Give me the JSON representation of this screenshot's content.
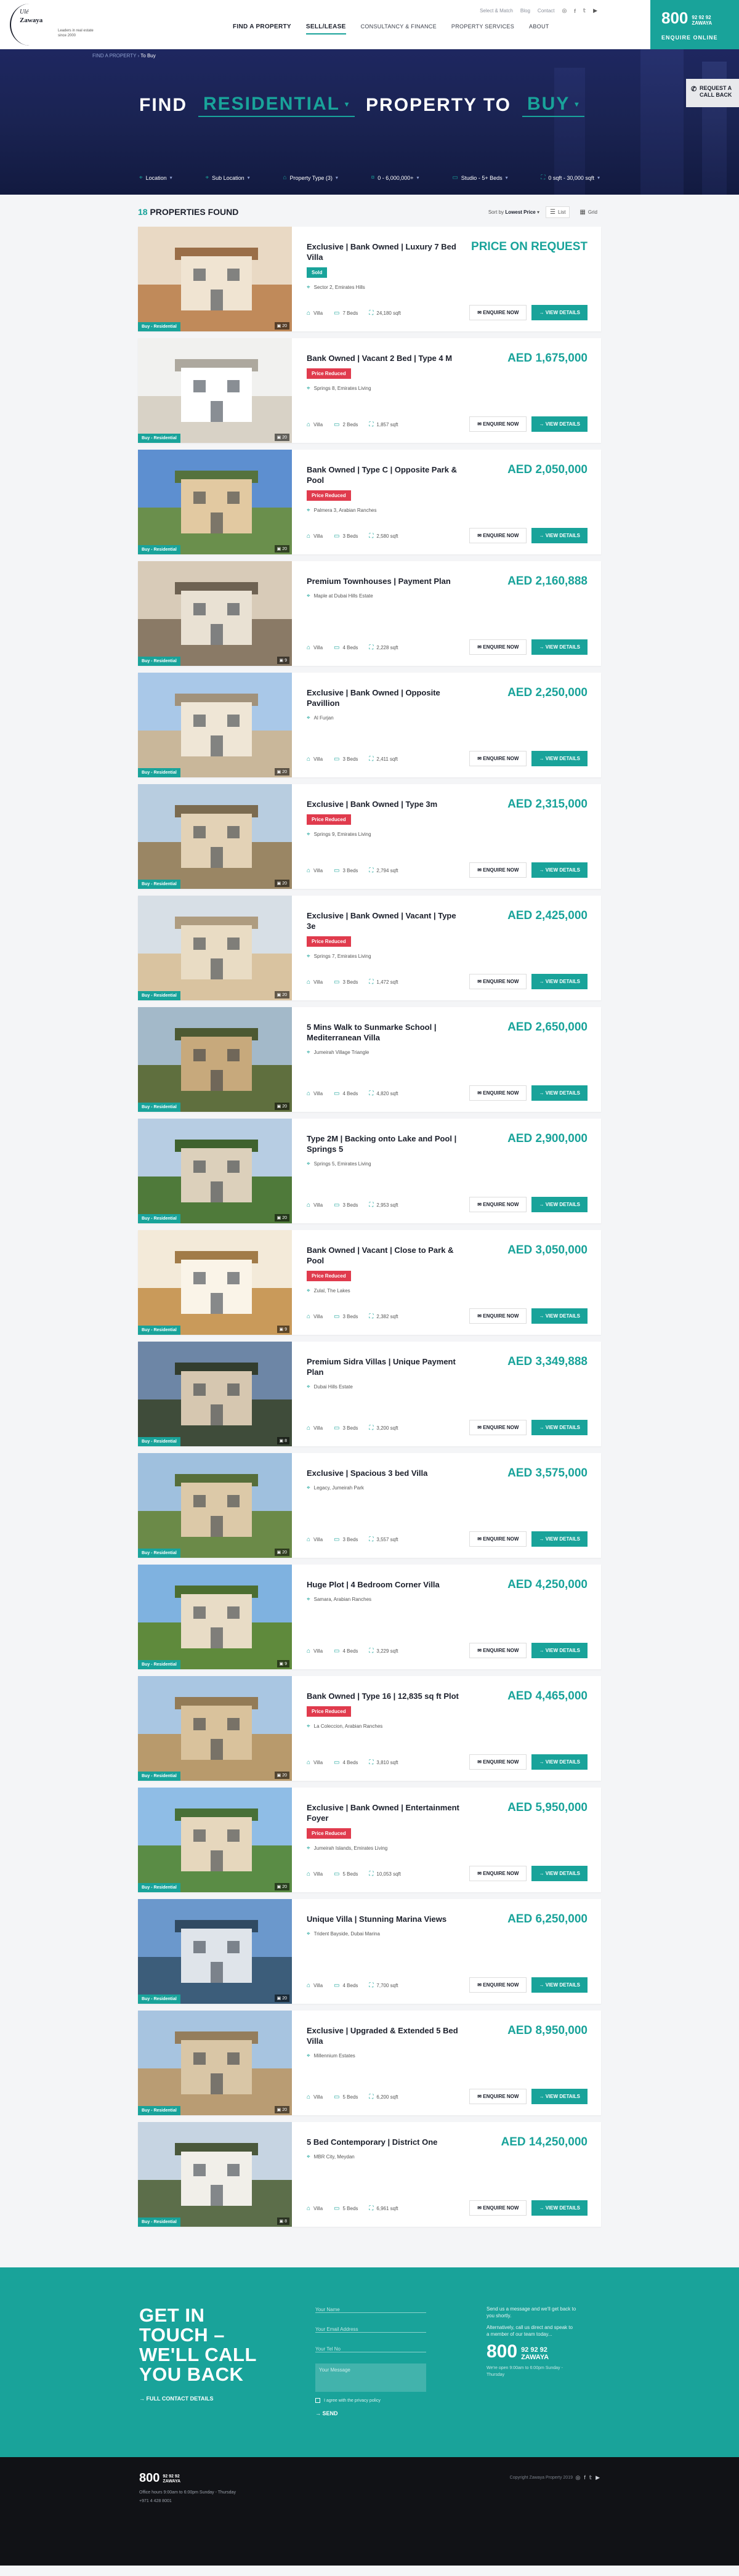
{
  "header": {
    "logo_line1": "Ulé",
    "logo_line2": "Zawaya",
    "tagline": "Leaders in real estate since 2000",
    "top_links": [
      "Select & Match",
      "Blog",
      "Contact"
    ],
    "social_icons": [
      "instagram",
      "facebook",
      "twitter",
      "youtube"
    ],
    "nav": [
      {
        "label": "FIND A PROPERTY",
        "active": false
      },
      {
        "label": "SELL/LEASE",
        "active": true
      },
      {
        "label": "CONSULTANCY & FINANCE",
        "active": false
      },
      {
        "label": "PROPERTY SERVICES",
        "active": false
      },
      {
        "label": "ABOUT",
        "active": false
      }
    ],
    "callbox": {
      "big": "800",
      "small": "92 92 92",
      "small2": "ZAWAYA",
      "cta": "ENQUIRE ONLINE"
    }
  },
  "hero": {
    "breadcrumb_prev": "FIND A PROPERTY",
    "breadcrumb_current": "To Buy",
    "find": "FIND",
    "type": "RESIDENTIAL",
    "property_to": "PROPERTY TO",
    "purpose": "BUY",
    "callback": [
      "REQUEST A",
      "CALL BACK"
    ],
    "filters": [
      {
        "icon": "location-icon",
        "label": "Location"
      },
      {
        "icon": "location-icon",
        "label": "Sub Location"
      },
      {
        "icon": "home-icon",
        "label": "Property Type (3)"
      },
      {
        "icon": "price-icon",
        "label": "0 - 6,000,000+"
      },
      {
        "icon": "bed-icon",
        "label": "Studio - 5+ Beds"
      },
      {
        "icon": "area-icon",
        "label": "0 sqft - 30,000 sqft"
      }
    ]
  },
  "listing": {
    "count": "18",
    "count_label": "PROPERTIES FOUND",
    "sort_prefix": "Sort by",
    "sort_value": "Lowest Price",
    "view_list": "List",
    "view_grid": "Grid",
    "enquire_label": "ENQUIRE NOW",
    "view_label": "VIEW DETAILS",
    "thumb_tag": "Buy - Residential",
    "properties": [
      {
        "title": "Exclusive | Bank Owned | Luxury 7 Bed Villa",
        "price": "PRICE ON REQUEST",
        "badge": "Sold",
        "badge_type": "sold",
        "location": "Sector 2, Emirates Hills",
        "type": "Villa",
        "beds": "7 Beds",
        "area": "24,180 sqft",
        "photos": "20",
        "palette": [
          "#e9d9c4",
          "#c08a5a",
          "#f0e4d2"
        ]
      },
      {
        "title": "Bank Owned | Vacant 2 Bed | Type 4 M",
        "price": "AED 1,675,000",
        "badge": "Price Reduced",
        "badge_type": "reduced",
        "location": "Springs 8, Emirates Living",
        "type": "Villa",
        "beds": "2 Beds",
        "area": "1,857 sqft",
        "photos": "20",
        "palette": [
          "#f1f1ef",
          "#d8d2c6",
          "#ffffff"
        ]
      },
      {
        "title": "Bank Owned | Type C | Opposite Park & Pool",
        "price": "AED 2,050,000",
        "badge": "Price Reduced",
        "badge_type": "reduced",
        "location": "Palmera 3, Arabian Ranches",
        "type": "Villa",
        "beds": "3 Beds",
        "area": "2,580 sqft",
        "photos": "20",
        "palette": [
          "#5d8fd0",
          "#6a8f4c",
          "#e2c9a1"
        ]
      },
      {
        "title": "Premium Townhouses | Payment Plan",
        "price": "AED 2,160,888",
        "badge": "",
        "badge_type": "",
        "location": "Maple at Dubai Hills Estate",
        "type": "Villa",
        "beds": "4 Beds",
        "area": "2,228 sqft",
        "photos": "9",
        "palette": [
          "#d8cbb8",
          "#8a7a66",
          "#e9e1d3"
        ]
      },
      {
        "title": "Exclusive | Bank Owned | Opposite Pavillion",
        "price": "AED 2,250,000",
        "badge": "",
        "badge_type": "",
        "location": "Al Furjan",
        "type": "Villa",
        "beds": "3 Beds",
        "area": "2,411 sqft",
        "photos": "20",
        "palette": [
          "#a9c8e8",
          "#c9b79a",
          "#efe6d6"
        ]
      },
      {
        "title": "Exclusive | Bank Owned | Type 3m",
        "price": "AED 2,315,000",
        "badge": "Price Reduced",
        "badge_type": "reduced",
        "location": "Springs 9, Emirates Living",
        "type": "Villa",
        "beds": "3 Beds",
        "area": "2,794 sqft",
        "photos": "20",
        "palette": [
          "#b8cde0",
          "#9a8664",
          "#e3d2b6"
        ]
      },
      {
        "title": "Exclusive | Bank Owned | Vacant | Type 3e",
        "price": "AED 2,425,000",
        "badge": "Price Reduced",
        "badge_type": "reduced",
        "location": "Springs 7, Emirates Living",
        "type": "Villa",
        "beds": "3 Beds",
        "area": "1,472 sqft",
        "photos": "20",
        "palette": [
          "#d7dfe6",
          "#d9c3a0",
          "#e9dcc4"
        ]
      },
      {
        "title": "5 Mins Walk to Sunmarke School | Mediterranean Villa",
        "price": "AED 2,650,000",
        "badge": "",
        "badge_type": "",
        "location": "Jumeirah Village Triangle",
        "type": "Villa",
        "beds": "4 Beds",
        "area": "4,820 sqft",
        "photos": "20",
        "palette": [
          "#a3b9c9",
          "#5f6f3e",
          "#c7a97c"
        ]
      },
      {
        "title": "Type 2M | Backing onto Lake and Pool | Springs 5",
        "price": "AED 2,900,000",
        "badge": "",
        "badge_type": "",
        "location": "Springs 5, Emirates Living",
        "type": "Villa",
        "beds": "3 Beds",
        "area": "2,953 sqft",
        "photos": "20",
        "palette": [
          "#b7cde3",
          "#4f7a3a",
          "#dcd0bb"
        ]
      },
      {
        "title": "Bank Owned | Vacant | Close to Park & Pool",
        "price": "AED 3,050,000",
        "badge": "Price Reduced",
        "badge_type": "reduced",
        "location": "Zulal, The Lakes",
        "type": "Villa",
        "beds": "3 Beds",
        "area": "2,382 sqft",
        "photos": "9",
        "palette": [
          "#f3ead9",
          "#c99a5a",
          "#faf4e8"
        ]
      },
      {
        "title": "Premium Sidra Villas | Unique Payment Plan",
        "price": "AED 3,349,888",
        "badge": "",
        "badge_type": "",
        "location": "Dubai Hills Estate",
        "type": "Villa",
        "beds": "3 Beds",
        "area": "3,200 sqft",
        "photos": "8",
        "palette": [
          "#6d86a6",
          "#3f4c3a",
          "#d6c7b0"
        ]
      },
      {
        "title": "Exclusive | Spacious 3 bed Villa",
        "price": "AED 3,575,000",
        "badge": "",
        "badge_type": "",
        "location": "Legacy, Jumeirah Park",
        "type": "Villa",
        "beds": "3 Beds",
        "area": "3,557 sqft",
        "photos": "20",
        "palette": [
          "#9fc0de",
          "#6b8a48",
          "#dcc9a8"
        ]
      },
      {
        "title": "Huge Plot | 4 Bedroom Corner Villa",
        "price": "AED 4,250,000",
        "badge": "",
        "badge_type": "",
        "location": "Samara, Arabian Ranches",
        "type": "Villa",
        "beds": "4 Beds",
        "area": "3,229 sqft",
        "photos": "9",
        "palette": [
          "#7fb2e0",
          "#5f8a3c",
          "#e8dcc6"
        ]
      },
      {
        "title": "Bank Owned | Type 16 | 12,835 sq ft Plot",
        "price": "AED 4,465,000",
        "badge": "Price Reduced",
        "badge_type": "reduced",
        "location": "La Coleccion, Arabian Ranches",
        "type": "Villa",
        "beds": "4 Beds",
        "area": "3,810 sqft",
        "photos": "20",
        "palette": [
          "#a9c6e2",
          "#b89a6c",
          "#d9c29c"
        ]
      },
      {
        "title": "Exclusive | Bank Owned | Entertainment Foyer",
        "price": "AED 5,950,000",
        "badge": "Price Reduced",
        "badge_type": "reduced",
        "location": "Jumeirah Islands, Emirates Living",
        "type": "Villa",
        "beds": "5 Beds",
        "area": "10,053 sqft",
        "photos": "20",
        "palette": [
          "#8fbde6",
          "#5a8c45",
          "#e6d7bd"
        ]
      },
      {
        "title": "Unique Villa | Stunning Marina Views",
        "price": "AED 6,250,000",
        "badge": "",
        "badge_type": "",
        "location": "Trident Bayside, Dubai Marina",
        "type": "Villa",
        "beds": "4 Beds",
        "area": "7,700 sqft",
        "photos": "20",
        "palette": [
          "#6b98cc",
          "#3c5d7a",
          "#dfe4ea"
        ]
      },
      {
        "title": "Exclusive | Upgraded & Extended 5 Bed Villa",
        "price": "AED 8,950,000",
        "badge": "",
        "badge_type": "",
        "location": "Millennium Estates",
        "type": "Villa",
        "beds": "5 Beds",
        "area": "6,200 sqft",
        "photos": "20",
        "palette": [
          "#a7c4e0",
          "#b99c73",
          "#d9c6a6"
        ]
      },
      {
        "title": "5 Bed Contemporary | District One",
        "price": "AED 14,250,000",
        "badge": "",
        "badge_type": "",
        "location": "MBR City, Meydan",
        "type": "Villa",
        "beds": "5 Beds",
        "area": "6,961 sqft",
        "photos": "8",
        "palette": [
          "#c6d4e2",
          "#5c6e4a",
          "#f1efe9"
        ]
      }
    ]
  },
  "contact": {
    "title_lines": [
      "GET IN",
      "TOUCH –",
      "WE'LL CALL",
      "YOU BACK"
    ],
    "details_link": "FULL CONTACT DETAILS",
    "form": {
      "name": "Your Name",
      "email": "Your Email Address",
      "phone": "Your Tel No",
      "message": "Your Message",
      "consent": "I agree with the privacy policy",
      "send": "SEND"
    },
    "blurb1": "Send us a message and we'll get back to you shortly.",
    "blurb2": "Alternatively, call us direct and speak to a member of our team today...",
    "phone_big": "800",
    "phone_small1": "92 92 92",
    "phone_small2": "ZAWAYA",
    "hours": "We're open 9:00am to 6:00pm Sunday - Thursday"
  },
  "footer": {
    "phone_big": "800",
    "phone_small1": "92 92 92",
    "phone_small2": "ZAWAYA",
    "hours": "Office hours 9:00am to 6:00pm Sunday - Thursday",
    "intl": "+971 4 428 8001",
    "copyright": "Copyright Zawaya Property 2019",
    "social_icons": [
      "instagram",
      "facebook",
      "twitter",
      "youtube"
    ]
  },
  "colors": {
    "accent": "#19a39a",
    "hero": "#1a2352",
    "reduced": "#e03b4d",
    "footer": "#111216"
  }
}
